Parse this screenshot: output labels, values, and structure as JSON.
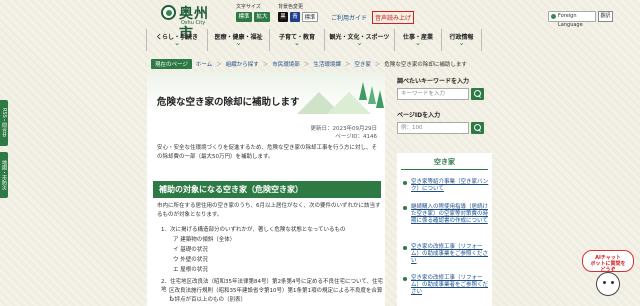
{
  "header": {
    "logo_name": "奥州市",
    "logo_en": "Oshu City",
    "text_size_label": "文字サイズ",
    "text_normal": "標準",
    "text_large": "拡大",
    "bg_color_label": "背景色変更",
    "bg_black": "黒",
    "bg_blue": "青",
    "bg_normal": "標準",
    "contact": "ご利用ガイド",
    "reading": "音声読み上げ",
    "language": "Foreign Language",
    "translate": "翻訳"
  },
  "colors": {
    "accent": "#2e7a45",
    "link": "#1c4f8a",
    "alert": "#c22"
  },
  "nav": [
    "くらし・手続き",
    "医療・健康・福祉",
    "子育て・教育",
    "観光・文化・スポーツ",
    "仕事・産業",
    "行政情報"
  ],
  "breadcrumb": {
    "here": "現在のページ",
    "items": [
      "ホーム",
      "組織から探す",
      "市民環境部",
      "生活環境課",
      "空き家",
      "危険な空き家の除却に補助します"
    ]
  },
  "main": {
    "title": "危険な空き家の除却に補助します",
    "updated": "更新日：2023年09月29日",
    "page_id": "ページID：4146",
    "lead": "安心・安全な住環境づくりを促進するため、危険な空き家の除却工事を行う方に対し、その除却費の一部（最大50万円）を補助します。",
    "h2": "補助の対象になる空き家（危険空き家）",
    "para": "市内に所在する居住用の空き家のうち、6月以上居住がなく、次の要件のいずれかに該当するものが対象となります。",
    "list1": "1．次に掲げる構造部分のいずれかが、著しく危険な状態となっているもの",
    "sub": [
      "ア 建築物の傾斜（全体）",
      "イ 基礎の状況",
      "ウ 外壁の状況",
      "エ 屋根の状況"
    ],
    "list2a": "2．住宅地区改良法（昭和35年法律第84号）第2条第4号に定める不良住宅について、住宅地",
    "list2b": "区改良法施行規則（昭和35年建設省令第10号）第1条第1項の規定による不良度を合算し",
    "list2c": "た評点が百以上のもの（別表）"
  },
  "right": {
    "kw_label": "調べたいキーワードを入力",
    "kw_placeholder": "キーワードを入力",
    "id_label": "ページIDを入力",
    "id_placeholder": "例：100",
    "side_head": "空き家",
    "links": [
      "空き家等紹介事業（空き家バンク）について",
      "継続購入の際使用指導（居続けた空き家）の空家等対策費の時期に係る確認書の作成について",
      "空き家の改修工事（リフォーム）の助成事業をご参照ください",
      "空き家の改修工事（リフォーム）の助成事業者をご参照ください"
    ]
  },
  "left_tabs": [
    "RSS・問合せ",
    "地図・市防災"
  ],
  "chatbot": {
    "line1": "AIチャット",
    "line2": "ボットに質問を",
    "line3": "どうぞ"
  }
}
